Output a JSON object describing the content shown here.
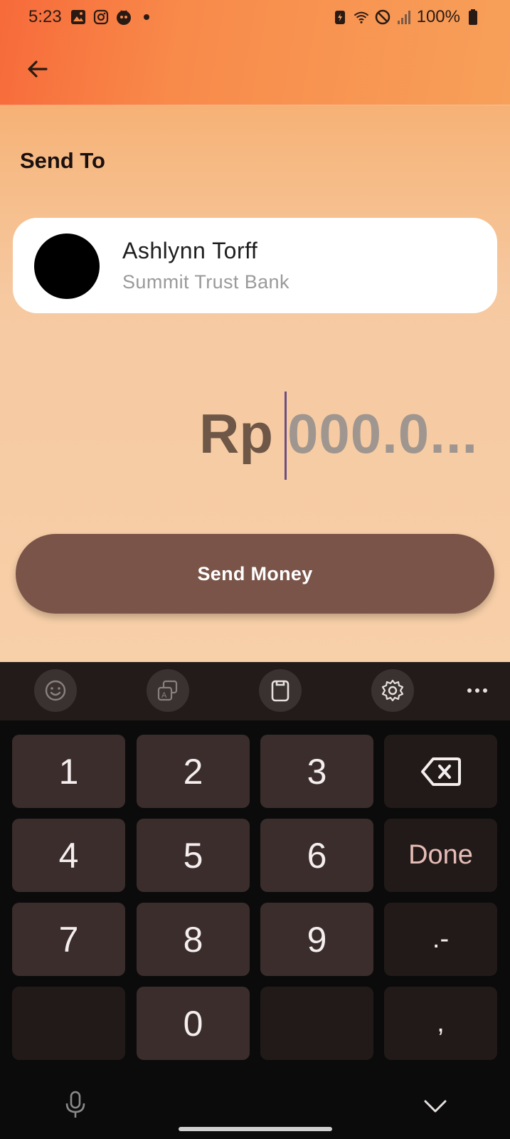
{
  "status_bar": {
    "time": "5:23",
    "battery": "100%"
  },
  "header": {
    "back_icon": "arrow-left-icon"
  },
  "send_to": {
    "title": "Send To",
    "recipient": {
      "name": "Ashlynn Torff",
      "bank": "Summit Trust Bank"
    }
  },
  "amount": {
    "currency": "Rp",
    "placeholder": "000.0..."
  },
  "actions": {
    "send_label": "Send Money"
  },
  "keyboard": {
    "toolbar_icons": [
      "emoji-icon",
      "translate-icon",
      "clipboard-icon",
      "settings-icon",
      "more-icon"
    ],
    "keys": {
      "k1": "1",
      "k2": "2",
      "k3": "3",
      "k4": "4",
      "k5": "5",
      "k6": "6",
      "k7": "7",
      "k8": "8",
      "k9": "9",
      "k0": "0",
      "done": "Done",
      "dot_minus": ".-",
      "comma": ","
    }
  },
  "colors": {
    "accent_orange": "#f76a3a",
    "button_brown": "#7a5448",
    "caret_purple": "#6b4f84"
  }
}
